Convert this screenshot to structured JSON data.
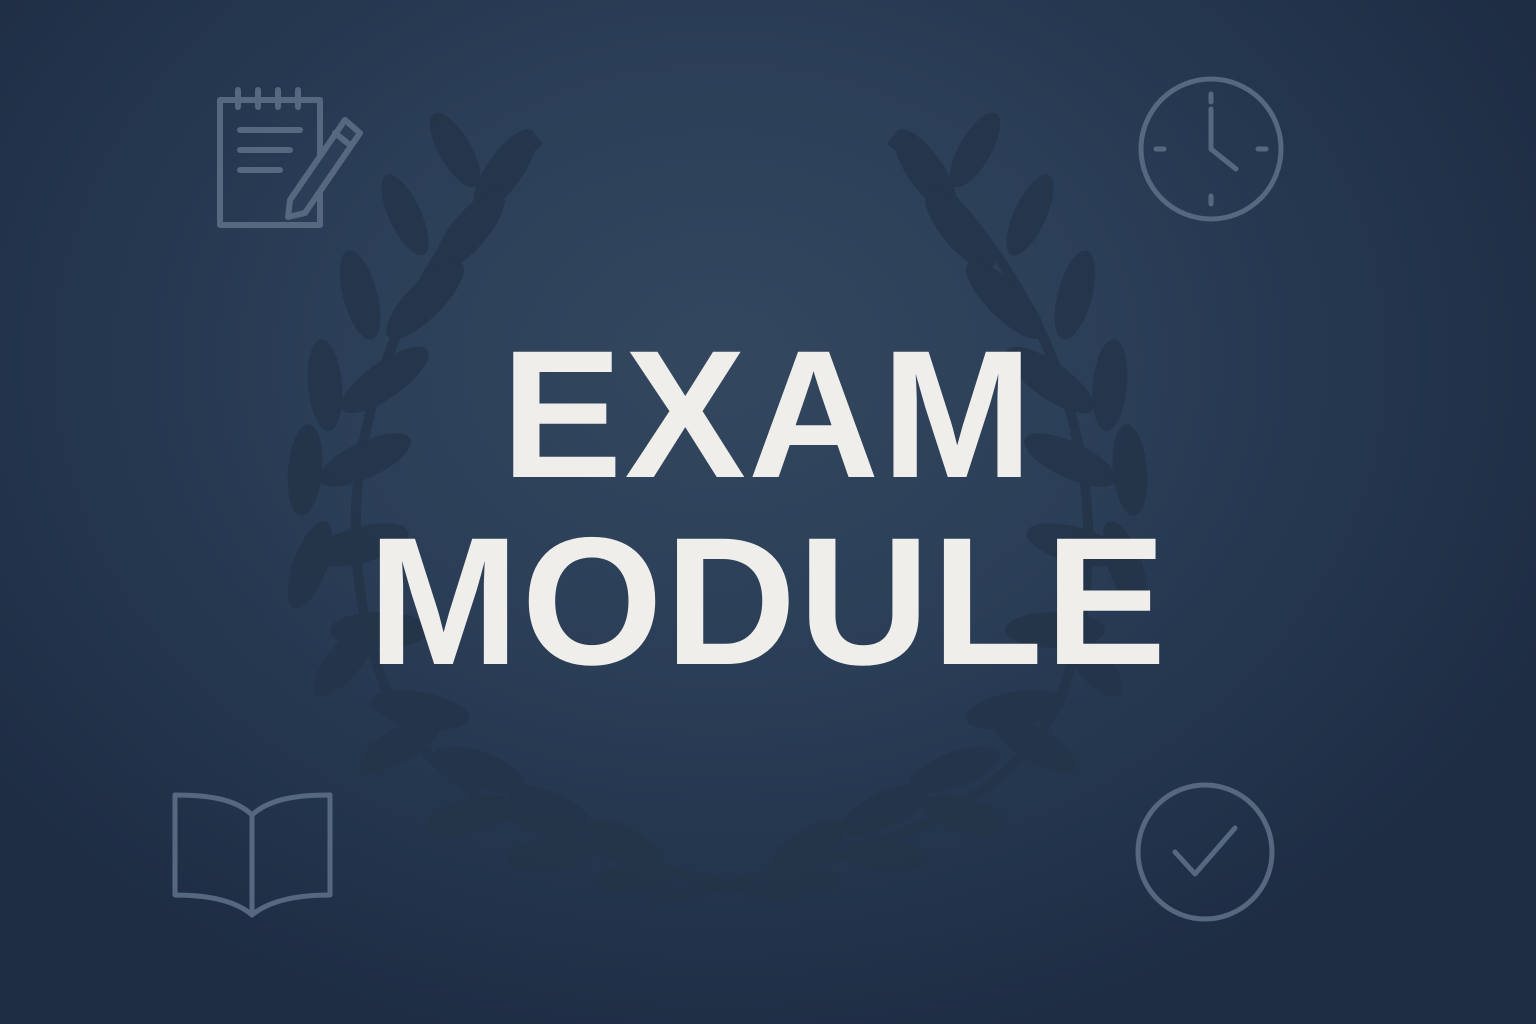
{
  "title": {
    "line1": "EXAM",
    "line2": "MODULE"
  },
  "icons": {
    "top_left": "notepad-pencil-icon",
    "top_right": "clock-icon",
    "bottom_left": "open-book-icon",
    "bottom_right": "check-circle-icon",
    "center_background": "laurel-wreath-icon"
  },
  "colors": {
    "background": "#2b3e57",
    "text": "#efeeea",
    "icon_stroke": "#5a6c85",
    "laurel": "#223248"
  }
}
